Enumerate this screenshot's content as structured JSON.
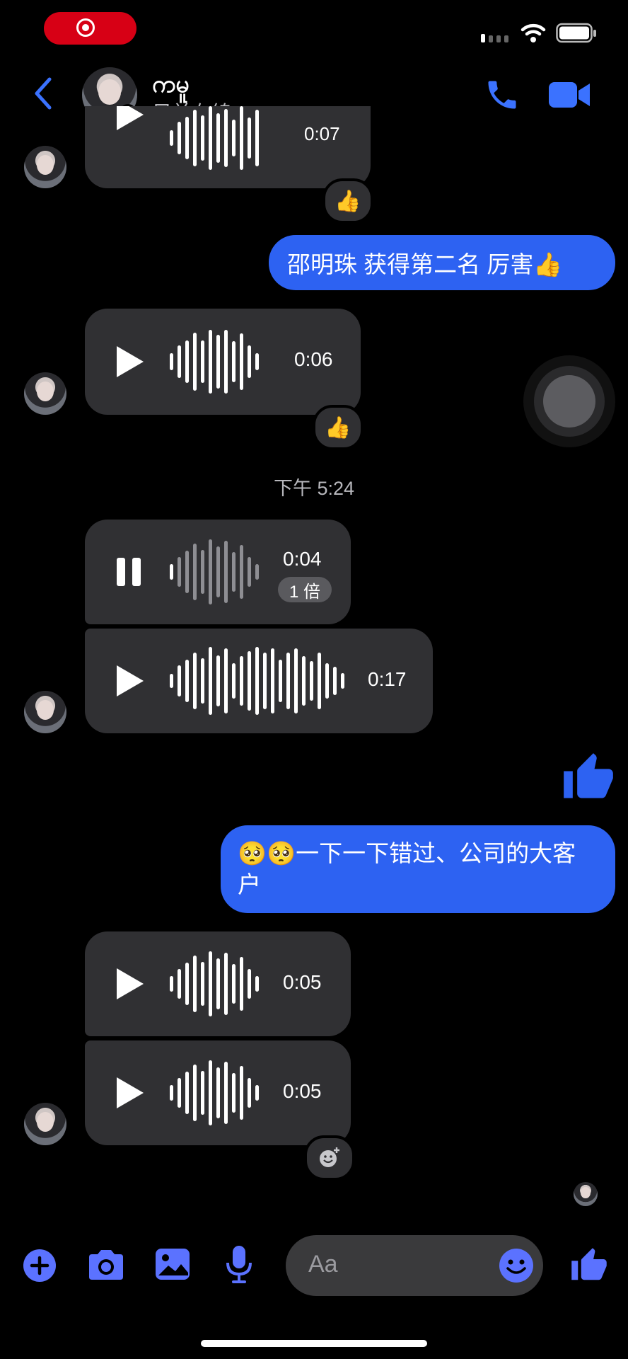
{
  "contact": {
    "name": "ကမူ",
    "status": "目前在線"
  },
  "messages": [
    {
      "from": "them",
      "kind": "audio",
      "duration": "0:07",
      "reaction": "👍"
    },
    {
      "from": "me",
      "kind": "text",
      "text": "邵明珠 获得第二名 厉害👍"
    },
    {
      "from": "them",
      "kind": "audio",
      "duration": "0:06",
      "reaction": "👍"
    },
    {
      "kind": "timestamp",
      "text": "下午 5:24"
    },
    {
      "from": "them",
      "kind": "audio",
      "duration": "0:04",
      "playing": true,
      "speed": "1 倍"
    },
    {
      "from": "them",
      "kind": "audio",
      "duration": "0:17"
    },
    {
      "from": "me",
      "kind": "like"
    },
    {
      "from": "me",
      "kind": "text",
      "text": "🥺🥺一下一下错过、公司的大客户"
    },
    {
      "from": "them",
      "kind": "audio",
      "duration": "0:05"
    },
    {
      "from": "them",
      "kind": "audio",
      "duration": "0:05"
    }
  ],
  "composer": {
    "placeholder": "Aa"
  },
  "colors": {
    "accent": "#2d62f2",
    "icon": "#5b72ff",
    "bubble_in": "#303033",
    "online": "#31a24c"
  }
}
